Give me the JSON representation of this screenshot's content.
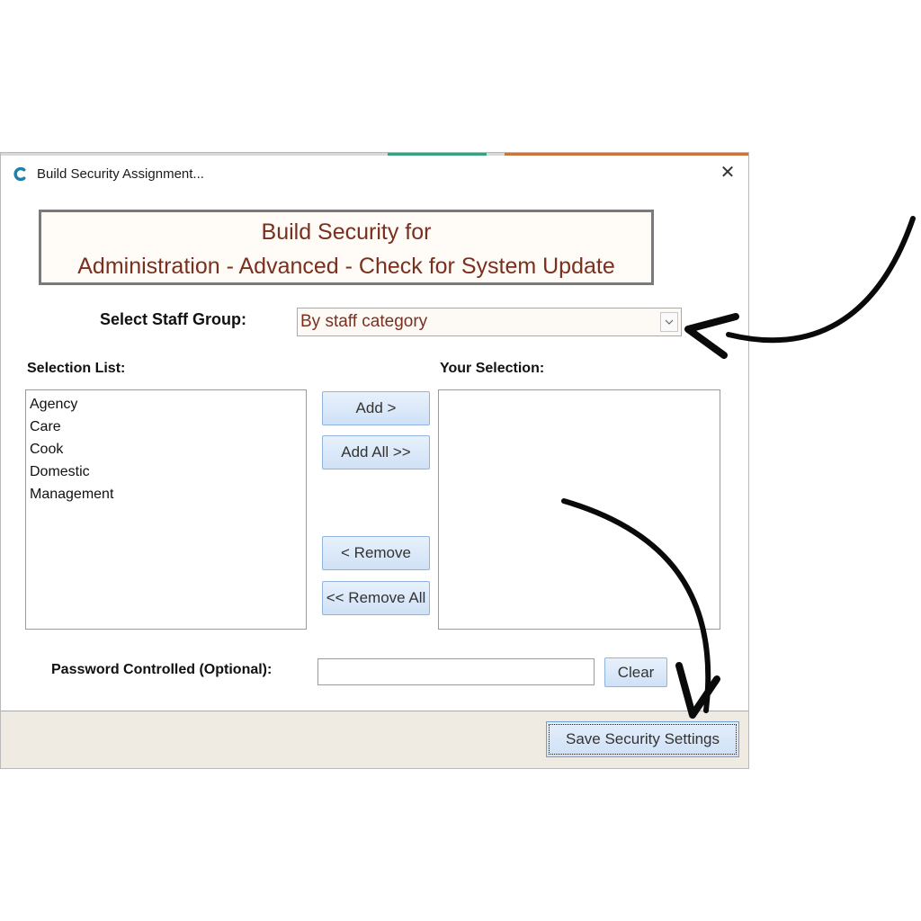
{
  "window": {
    "title": "Build Security Assignment...",
    "close_glyph": "✕",
    "app_icon": "c-logo-icon"
  },
  "banner": {
    "line1": "Build Security for",
    "line2": "Administration - Advanced - Check for System Update"
  },
  "staff_group": {
    "label": "Select Staff Group:",
    "selected": "By staff category"
  },
  "selection_list": {
    "label": "Selection List:",
    "items": [
      "Agency",
      "Care",
      "Cook",
      "Domestic",
      "Management"
    ]
  },
  "your_selection": {
    "label": "Your Selection:",
    "items": []
  },
  "buttons": {
    "add": "Add >",
    "add_all": "Add All >>",
    "remove": "< Remove",
    "remove_all": "<< Remove All",
    "clear": "Clear",
    "save": "Save Security Settings"
  },
  "password": {
    "label": "Password Controlled (Optional):",
    "value": ""
  },
  "colors": {
    "banner_text": "#7a2f1f",
    "button_border": "#8fb4df",
    "footer_bg": "#efebe2"
  }
}
